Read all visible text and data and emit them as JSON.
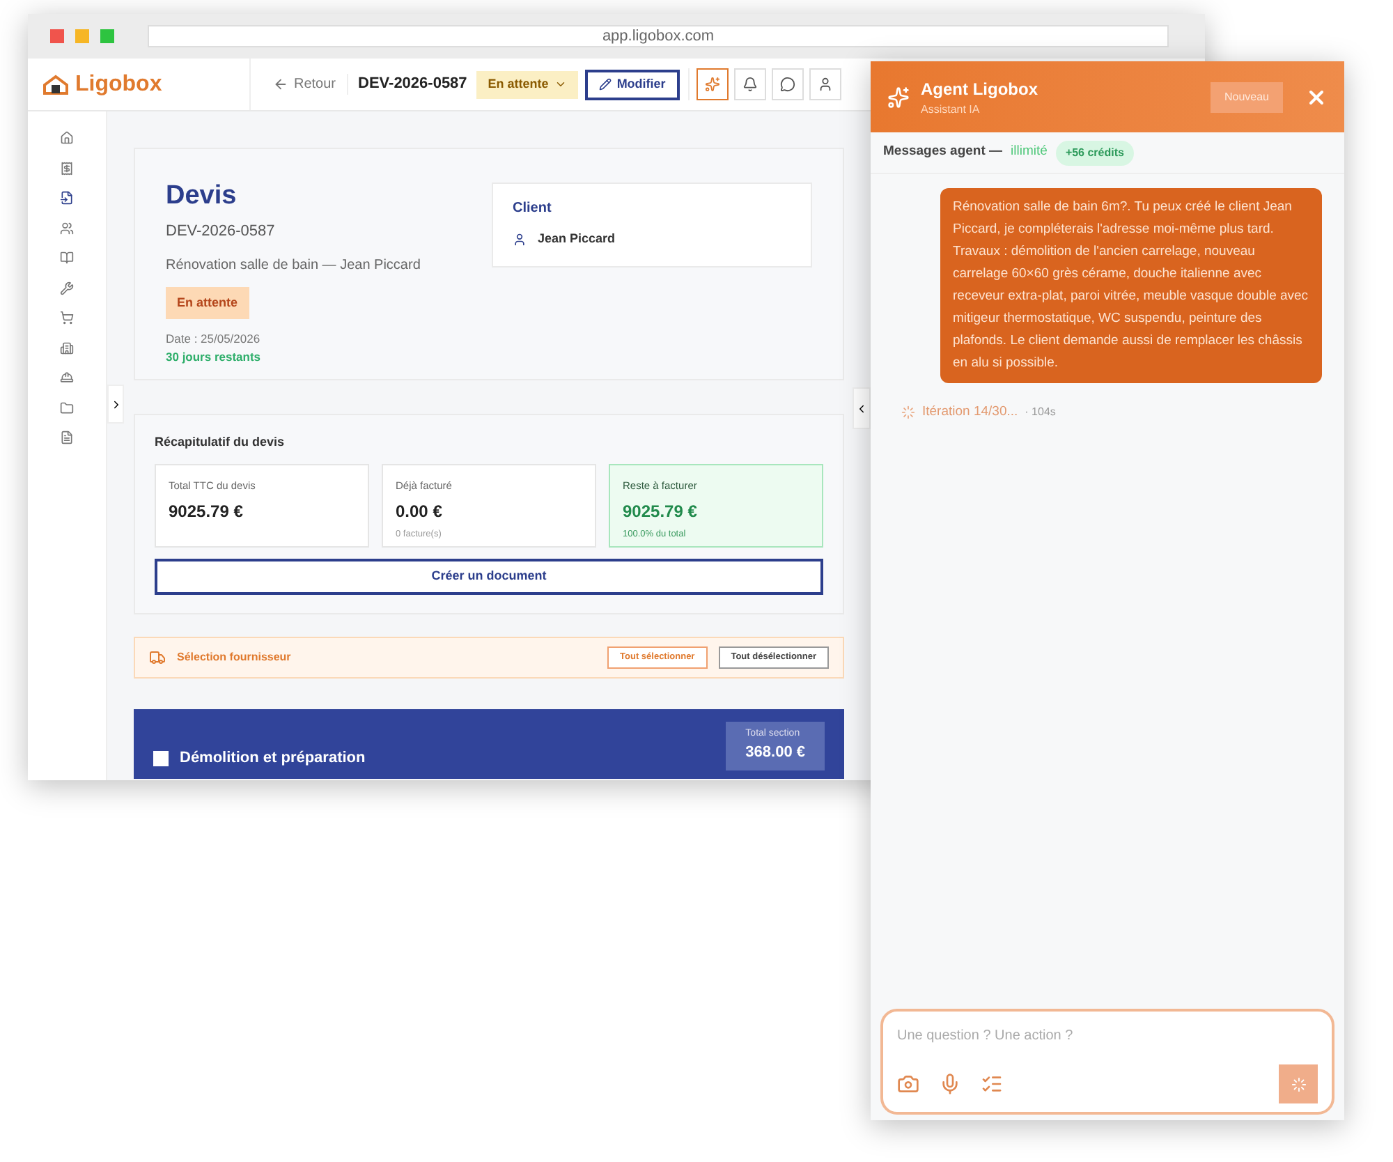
{
  "browser": {
    "url": "app.ligobox.com"
  },
  "header": {
    "logo": "Ligobox",
    "back": "Retour",
    "doc_number": "DEV-2026-0587",
    "status": "En attente",
    "edit": "Modifier",
    "ai_active": true
  },
  "sidebar": {
    "items": [
      {
        "selected": false
      },
      {
        "selected": false
      },
      {
        "selected": true
      },
      {
        "selected": false
      },
      {
        "selected": false
      },
      {
        "selected": false
      },
      {
        "selected": false
      },
      {
        "selected": false
      },
      {
        "selected": false
      },
      {
        "selected": false
      },
      {
        "selected": false
      }
    ]
  },
  "quote": {
    "title": "Devis",
    "number": "DEV-2026-0587",
    "subtitle": "Rénovation salle de bain — Jean Piccard",
    "status": "En attente",
    "date": "Date : 25/05/2026",
    "remaining": "30 jours restants",
    "client_label": "Client",
    "client_name": "Jean Piccard"
  },
  "summary": {
    "title": "Récapitulatif du devis",
    "cards": [
      {
        "label": "Total TTC du devis",
        "value": "9025.79 €",
        "highlight": false
      },
      {
        "label": "Déjà facturé",
        "value": "0.00 €",
        "note": "0 facture(s)",
        "highlight": false
      },
      {
        "label": "Reste à facturer",
        "value": "9025.79 €",
        "note": "100.0% du total",
        "highlight": true
      }
    ],
    "create_button": "Créer un document"
  },
  "supplier": {
    "title": "Sélection fournisseur",
    "select_all": "Tout sélectionner",
    "deselect_all": "Tout désélectionner"
  },
  "section": {
    "checked": false,
    "title": "Démolition et préparation",
    "total_label": "Total section",
    "total": "368.00 €"
  },
  "agent": {
    "title": "Agent Ligobox",
    "subtitle": "Assistant IA",
    "new_button": "Nouveau",
    "quota_label": "Messages agent —",
    "quota_value": "illimité",
    "credits": "+56 crédits",
    "messages": [
      {
        "text": "Rénovation salle de bain 6m?. Tu peux créé le client Jean Piccard, je compléterais l'adresse moi-même plus tard. Travaux : démolition de l'ancien carrelage, nouveau carrelage 60×60 grès cérame, douche italienne avec receveur extra-plat, paroi vitrée, meuble vasque double avec mitigeur thermostatique, WC suspendu, peinture des plafonds. Le client demande aussi de remplacer les châssis en alu si possible."
      }
    ],
    "progress": "Itération 14/30...",
    "elapsed": "· 104s",
    "input_placeholder": "Une question ? Une action ?",
    "busy": true
  }
}
